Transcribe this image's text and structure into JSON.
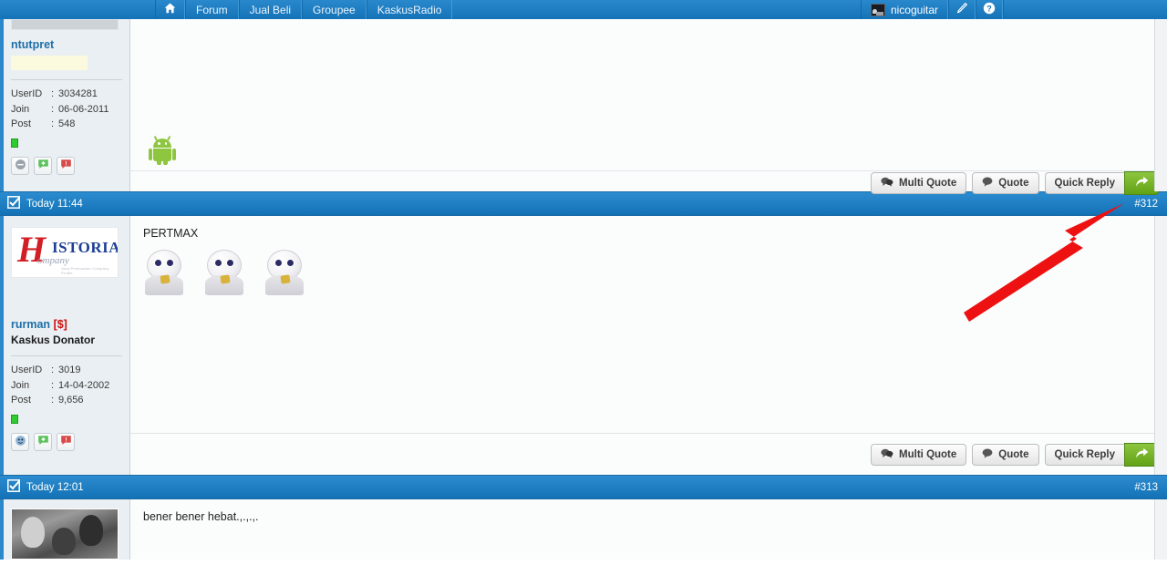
{
  "nav": {
    "home_icon": "home-icon",
    "items": [
      {
        "label": "Forum"
      },
      {
        "label": "Jual Beli"
      },
      {
        "label": "Groupee"
      },
      {
        "label": "KaskusRadio"
      }
    ],
    "user": {
      "name": "nicoguitar",
      "avatar_icon": "user-avatar-icon"
    },
    "edit_icon": "pencil-icon",
    "help_icon": "question-mark-icon",
    "bg_color": "#1a7ac4"
  },
  "posts": [
    {
      "user": {
        "name": "ntutpret",
        "title": "",
        "avatar_type": "placeholder-bar",
        "fields": [
          {
            "key": "UserID",
            "value": "3034281"
          },
          {
            "key": "Join",
            "value": "06-06-2011"
          },
          {
            "key": "Post",
            "value": "548"
          }
        ],
        "status": "online",
        "action_icons": [
          "profile-icon",
          "reputation-add-icon",
          "report-icon"
        ]
      },
      "content": {
        "text": "",
        "has_android_icon": true,
        "emoticons": 0
      },
      "actions": {
        "multi_quote": "Multi Quote",
        "quote": "Quote",
        "quick_reply": "Quick Reply",
        "go_icon": "arrow-reply-icon"
      }
    },
    {
      "meta": {
        "timestamp": "Today 11:44",
        "number": "#312",
        "icon": "checkbox-icon"
      },
      "user": {
        "name": "rurman",
        "badge": "[$]",
        "title": "Kaskus Donator",
        "avatar_type": "historia-logo",
        "logo": {
          "initial": "H",
          "word": "ISTORIA",
          "sub": "ompany",
          "tiny": "Jasa Pembuatan Company Profile"
        },
        "fields": [
          {
            "key": "UserID",
            "value": "3019"
          },
          {
            "key": "Join",
            "value": "14-04-2002"
          },
          {
            "key": "Post",
            "value": "9,656"
          }
        ],
        "status": "online",
        "action_icons": [
          "profile-icon",
          "reputation-add-icon",
          "report-icon"
        ]
      },
      "content": {
        "text": "PERTMAX",
        "has_android_icon": false,
        "emoticons": 3
      },
      "actions": {
        "multi_quote": "Multi Quote",
        "quote": "Quote",
        "quick_reply": "Quick Reply",
        "go_icon": "arrow-reply-icon"
      }
    },
    {
      "meta": {
        "timestamp": "Today 12:01",
        "number": "#313",
        "icon": "checkbox-icon"
      },
      "user": {
        "name": "",
        "title": "",
        "avatar_type": "photo",
        "fields": [],
        "status": "",
        "action_icons": []
      },
      "content": {
        "text": "bener bener hebat.,.,.,.",
        "has_android_icon": false,
        "emoticons": 0
      }
    }
  ],
  "annotation": {
    "type": "red-arrow",
    "color": "#ee1111",
    "points_to": "#312"
  },
  "colors": {
    "nav_blue": "#1a7ac4",
    "metabar_blue": "#1e7fc2",
    "sidebar_bg": "#e9eff3",
    "content_bg": "#fbfcfc",
    "username_blue": "#1f6fa8",
    "donator_red": "#cc1111",
    "green_button": "#7bb52b",
    "online_green": "#2ecc2e",
    "highlight_yellow": "#fcfade"
  }
}
